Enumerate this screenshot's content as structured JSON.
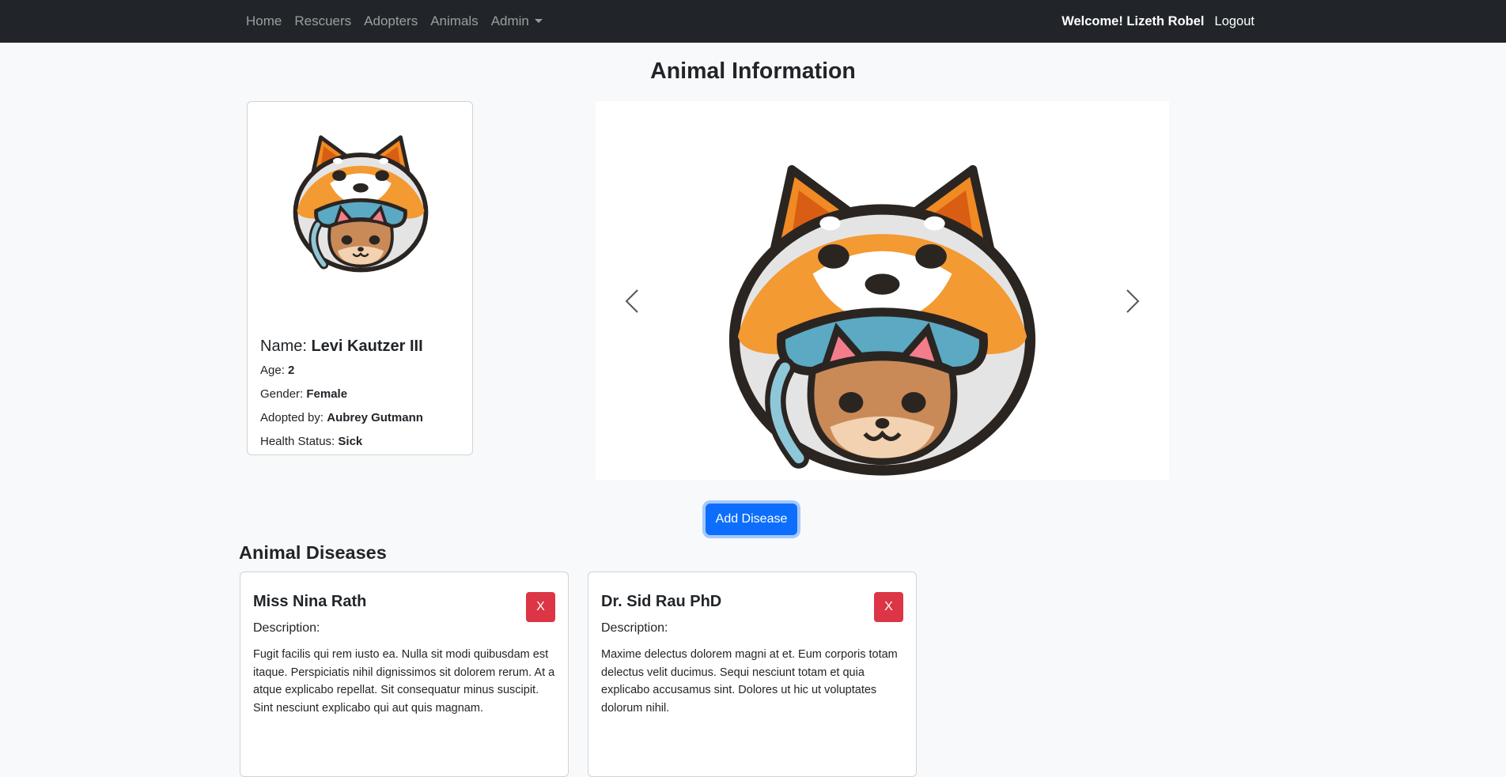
{
  "nav": {
    "links": [
      "Home",
      "Rescuers",
      "Adopters",
      "Animals"
    ],
    "admin_label": "Admin",
    "welcome": "Welcome! Lizeth Robel",
    "logout": "Logout"
  },
  "page_title": "Animal Information",
  "animal": {
    "name_label": "Name:",
    "name": "Levi Kautzer III",
    "age_label": "Age:",
    "age": "2",
    "gender_label": "Gender:",
    "gender": "Female",
    "adopted_label": "Adopted by:",
    "adopted_by": "Aubrey Gutmann",
    "health_label": "Health Status:",
    "health_status": "Sick"
  },
  "add_disease_label": "Add Disease",
  "diseases_title": "Animal Diseases",
  "diseases": [
    {
      "title": "Miss Nina Rath",
      "delete_label": "X",
      "desc_label": "Description:",
      "description": "Fugit facilis qui rem iusto ea. Nulla sit modi quibusdam est itaque. Perspiciatis nihil dignissimos sit dolorem rerum. At a atque explicabo repellat. Sit consequatur minus suscipit. Sint nesciunt explicabo qui aut quis magnam."
    },
    {
      "title": "Dr. Sid Rau PhD",
      "delete_label": "X",
      "desc_label": "Description:",
      "description": "Maxime delectus dolorem magni at et. Eum corporis totam delectus velit ducimus. Sequi nesciunt totam et quia explicabo accusamus sint. Dolores ut hic ut voluptates dolorum nihil."
    }
  ],
  "colors": {
    "navbar": "#212529",
    "primary": "#0d6efd",
    "danger": "#dc3545",
    "shiba_orange": "#f08a24"
  }
}
